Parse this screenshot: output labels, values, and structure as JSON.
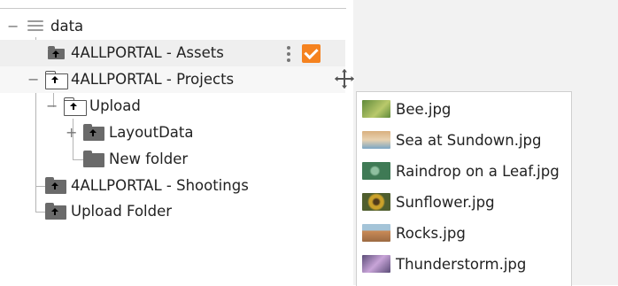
{
  "tree": {
    "root": {
      "label": "data",
      "expander": "−",
      "icon": "database-icon"
    },
    "items": [
      {
        "label": "4ALLPORTAL - Assets"
      },
      {
        "label": "4ALLPORTAL - Projects",
        "expander": "−"
      },
      {
        "label": "Upload",
        "expander": "−"
      },
      {
        "label": "LayoutData",
        "expander": "+"
      },
      {
        "label": "New folder"
      },
      {
        "label": "4ALLPORTAL - Shootings"
      },
      {
        "label": "Upload Folder"
      }
    ]
  },
  "row_actions": {
    "menu_icon": "kebab-menu-icon",
    "checkbox_checked": true,
    "checkbox_color": "#f5821f"
  },
  "drag_preview": {
    "cursor_icon": "move-cursor-icon",
    "files": [
      {
        "name": "Bee.jpg",
        "thumb_colors": [
          "#5f8a3a",
          "#b9c96b"
        ]
      },
      {
        "name": "Sea at Sundown.jpg",
        "thumb_colors": [
          "#d9b07e",
          "#7aa6c4"
        ]
      },
      {
        "name": "Raindrop on a Leaf.jpg",
        "thumb_colors": [
          "#3f7a55",
          "#8fc0a0"
        ]
      },
      {
        "name": "Sunflower.jpg",
        "thumb_colors": [
          "#caa12a",
          "#4f5e2e"
        ]
      },
      {
        "name": "Rocks.jpg",
        "thumb_colors": [
          "#c98a57",
          "#a4c4d8"
        ]
      },
      {
        "name": "Thunderstorm.jpg",
        "thumb_colors": [
          "#5c4d78",
          "#c8a4d8"
        ]
      }
    ]
  }
}
